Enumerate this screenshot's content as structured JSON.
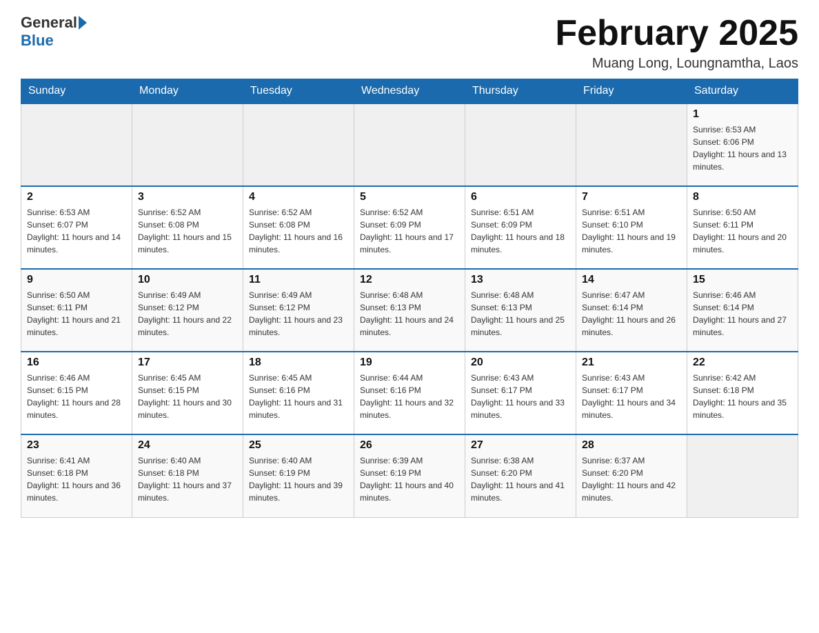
{
  "header": {
    "logo": {
      "general": "General",
      "blue": "Blue"
    },
    "title": "February 2025",
    "location": "Muang Long, Loungnamtha, Laos"
  },
  "days_of_week": [
    "Sunday",
    "Monday",
    "Tuesday",
    "Wednesday",
    "Thursday",
    "Friday",
    "Saturday"
  ],
  "weeks": [
    [
      {
        "day": "",
        "sunrise": "",
        "sunset": "",
        "daylight": ""
      },
      {
        "day": "",
        "sunrise": "",
        "sunset": "",
        "daylight": ""
      },
      {
        "day": "",
        "sunrise": "",
        "sunset": "",
        "daylight": ""
      },
      {
        "day": "",
        "sunrise": "",
        "sunset": "",
        "daylight": ""
      },
      {
        "day": "",
        "sunrise": "",
        "sunset": "",
        "daylight": ""
      },
      {
        "day": "",
        "sunrise": "",
        "sunset": "",
        "daylight": ""
      },
      {
        "day": "1",
        "sunrise": "Sunrise: 6:53 AM",
        "sunset": "Sunset: 6:06 PM",
        "daylight": "Daylight: 11 hours and 13 minutes."
      }
    ],
    [
      {
        "day": "2",
        "sunrise": "Sunrise: 6:53 AM",
        "sunset": "Sunset: 6:07 PM",
        "daylight": "Daylight: 11 hours and 14 minutes."
      },
      {
        "day": "3",
        "sunrise": "Sunrise: 6:52 AM",
        "sunset": "Sunset: 6:08 PM",
        "daylight": "Daylight: 11 hours and 15 minutes."
      },
      {
        "day": "4",
        "sunrise": "Sunrise: 6:52 AM",
        "sunset": "Sunset: 6:08 PM",
        "daylight": "Daylight: 11 hours and 16 minutes."
      },
      {
        "day": "5",
        "sunrise": "Sunrise: 6:52 AM",
        "sunset": "Sunset: 6:09 PM",
        "daylight": "Daylight: 11 hours and 17 minutes."
      },
      {
        "day": "6",
        "sunrise": "Sunrise: 6:51 AM",
        "sunset": "Sunset: 6:09 PM",
        "daylight": "Daylight: 11 hours and 18 minutes."
      },
      {
        "day": "7",
        "sunrise": "Sunrise: 6:51 AM",
        "sunset": "Sunset: 6:10 PM",
        "daylight": "Daylight: 11 hours and 19 minutes."
      },
      {
        "day": "8",
        "sunrise": "Sunrise: 6:50 AM",
        "sunset": "Sunset: 6:11 PM",
        "daylight": "Daylight: 11 hours and 20 minutes."
      }
    ],
    [
      {
        "day": "9",
        "sunrise": "Sunrise: 6:50 AM",
        "sunset": "Sunset: 6:11 PM",
        "daylight": "Daylight: 11 hours and 21 minutes."
      },
      {
        "day": "10",
        "sunrise": "Sunrise: 6:49 AM",
        "sunset": "Sunset: 6:12 PM",
        "daylight": "Daylight: 11 hours and 22 minutes."
      },
      {
        "day": "11",
        "sunrise": "Sunrise: 6:49 AM",
        "sunset": "Sunset: 6:12 PM",
        "daylight": "Daylight: 11 hours and 23 minutes."
      },
      {
        "day": "12",
        "sunrise": "Sunrise: 6:48 AM",
        "sunset": "Sunset: 6:13 PM",
        "daylight": "Daylight: 11 hours and 24 minutes."
      },
      {
        "day": "13",
        "sunrise": "Sunrise: 6:48 AM",
        "sunset": "Sunset: 6:13 PM",
        "daylight": "Daylight: 11 hours and 25 minutes."
      },
      {
        "day": "14",
        "sunrise": "Sunrise: 6:47 AM",
        "sunset": "Sunset: 6:14 PM",
        "daylight": "Daylight: 11 hours and 26 minutes."
      },
      {
        "day": "15",
        "sunrise": "Sunrise: 6:46 AM",
        "sunset": "Sunset: 6:14 PM",
        "daylight": "Daylight: 11 hours and 27 minutes."
      }
    ],
    [
      {
        "day": "16",
        "sunrise": "Sunrise: 6:46 AM",
        "sunset": "Sunset: 6:15 PM",
        "daylight": "Daylight: 11 hours and 28 minutes."
      },
      {
        "day": "17",
        "sunrise": "Sunrise: 6:45 AM",
        "sunset": "Sunset: 6:15 PM",
        "daylight": "Daylight: 11 hours and 30 minutes."
      },
      {
        "day": "18",
        "sunrise": "Sunrise: 6:45 AM",
        "sunset": "Sunset: 6:16 PM",
        "daylight": "Daylight: 11 hours and 31 minutes."
      },
      {
        "day": "19",
        "sunrise": "Sunrise: 6:44 AM",
        "sunset": "Sunset: 6:16 PM",
        "daylight": "Daylight: 11 hours and 32 minutes."
      },
      {
        "day": "20",
        "sunrise": "Sunrise: 6:43 AM",
        "sunset": "Sunset: 6:17 PM",
        "daylight": "Daylight: 11 hours and 33 minutes."
      },
      {
        "day": "21",
        "sunrise": "Sunrise: 6:43 AM",
        "sunset": "Sunset: 6:17 PM",
        "daylight": "Daylight: 11 hours and 34 minutes."
      },
      {
        "day": "22",
        "sunrise": "Sunrise: 6:42 AM",
        "sunset": "Sunset: 6:18 PM",
        "daylight": "Daylight: 11 hours and 35 minutes."
      }
    ],
    [
      {
        "day": "23",
        "sunrise": "Sunrise: 6:41 AM",
        "sunset": "Sunset: 6:18 PM",
        "daylight": "Daylight: 11 hours and 36 minutes."
      },
      {
        "day": "24",
        "sunrise": "Sunrise: 6:40 AM",
        "sunset": "Sunset: 6:18 PM",
        "daylight": "Daylight: 11 hours and 37 minutes."
      },
      {
        "day": "25",
        "sunrise": "Sunrise: 6:40 AM",
        "sunset": "Sunset: 6:19 PM",
        "daylight": "Daylight: 11 hours and 39 minutes."
      },
      {
        "day": "26",
        "sunrise": "Sunrise: 6:39 AM",
        "sunset": "Sunset: 6:19 PM",
        "daylight": "Daylight: 11 hours and 40 minutes."
      },
      {
        "day": "27",
        "sunrise": "Sunrise: 6:38 AM",
        "sunset": "Sunset: 6:20 PM",
        "daylight": "Daylight: 11 hours and 41 minutes."
      },
      {
        "day": "28",
        "sunrise": "Sunrise: 6:37 AM",
        "sunset": "Sunset: 6:20 PM",
        "daylight": "Daylight: 11 hours and 42 minutes."
      },
      {
        "day": "",
        "sunrise": "",
        "sunset": "",
        "daylight": ""
      }
    ]
  ]
}
